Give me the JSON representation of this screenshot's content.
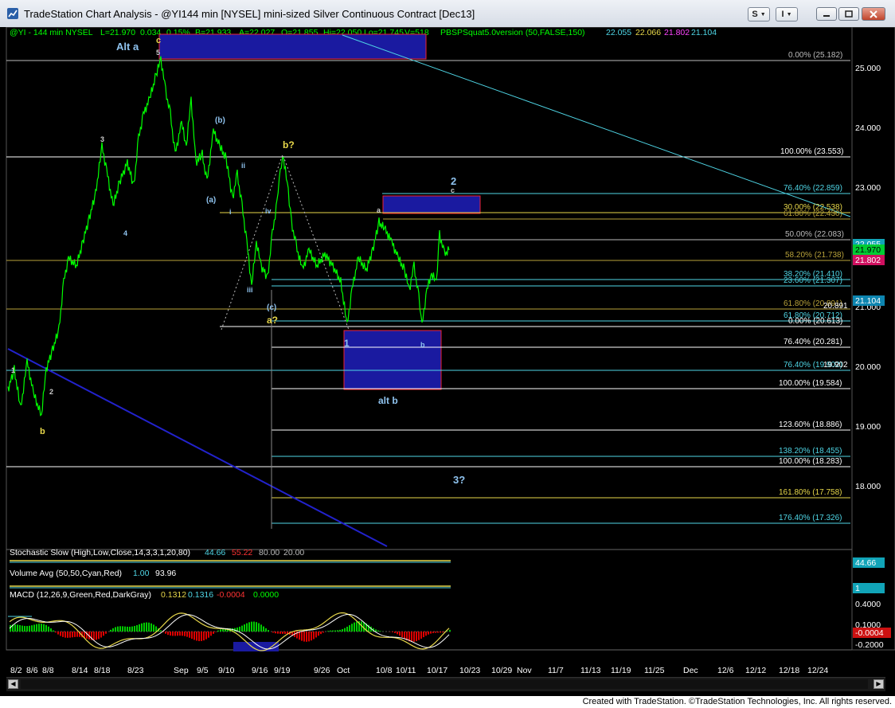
{
  "window": {
    "title": "TradeStation Chart Analysis - @YI144 min [NYSEL] mini-sized Silver Continuous Contract [Dec13]",
    "btn_s": "S",
    "btn_i": "I"
  },
  "header_line": {
    "symbol": "@YI - 144 min  NYSEL",
    "last": "L=21.970",
    "chg": "0.034",
    "pct": "0.15%",
    "bid": "B=21.933",
    "ask": "A=22.027",
    "open": "O=21.855",
    "high": "Hi=22.050",
    "low": "Lo=21.745",
    "vol": "V=518",
    "study": "PBSPSquat5.0version (50,FALSE,150)",
    "v1": "22.055",
    "v2": "22.066",
    "v3": "21.802",
    "v4": "21.104"
  },
  "colors": {
    "bg": "#000000",
    "price": "#00ff00",
    "fib_line": "#b9c0c6",
    "trend_cyan": "#4fd6e6",
    "trend_blue": "#2222cc",
    "box_blue": "#1a1aa0",
    "wave_yellow": "#e8d84a",
    "wave_blue": "#8fc3ef"
  },
  "price_axis": {
    "labels": [
      "25.000",
      "24.000",
      "23.000",
      "22.000",
      "21.000",
      "20.000",
      "19.000",
      "18.000"
    ],
    "badges": [
      "22.055",
      "21.970",
      "21.802",
      "21.104"
    ]
  },
  "fib_labels": [
    "0.00% (25.182)",
    "100.00% (23.553)",
    "76.40% (22.859)",
    "30.00% (22.538)",
    "61.80% (22.430)",
    "50.00% (22.083)",
    "58.20% (21.738)",
    "38.20% (21.410)",
    "23.60% (21.307)",
    "61.80% (20.891)",
    "20.891",
    "61.80% (20.712)",
    "0.00% (20.613)",
    "76.40% (20.281)",
    "76.40% (19.902)",
    "19.902",
    "100.00% (19.584)",
    "123.60% (18.886)",
    "138.20% (18.455)",
    "100.00% (18.283)",
    "161.80% (17.758)",
    "176.40% (17.326)"
  ],
  "wave_labels": [
    "Alt a",
    "c",
    "5",
    "3",
    "4",
    "1",
    "2",
    "b",
    "(b)",
    "(a)",
    "ii",
    "i",
    "iv",
    "iii",
    "b?",
    "(c)",
    "a?",
    "a",
    "2",
    "c",
    "1",
    "b",
    "alt b",
    "3?"
  ],
  "x_axis": [
    "8/2",
    "8/6",
    "8/8",
    "8/14",
    "8/18",
    "8/23",
    "Sep",
    "9/5",
    "9/10",
    "9/16",
    "9/19",
    "9/26",
    "Oct",
    "10/8",
    "10/11",
    "10/17",
    "10/23",
    "10/29",
    "Nov",
    "11/7",
    "11/13",
    "11/19",
    "11/25",
    "Dec",
    "12/6",
    "12/12",
    "12/18",
    "12/24"
  ],
  "indicators": {
    "stoch": {
      "label": "Stochastic Slow (High,Low,Close,14,3,3,1,20,80)",
      "v1": "44.66",
      "v2": "55.22",
      "v3": "80.00",
      "v4": "20.00",
      "badge": "44.66"
    },
    "volume": {
      "label": "Volume Avg (50,50,Cyan,Red)",
      "v1": "1.00",
      "v2": "93.96",
      "badge": "1"
    },
    "macd": {
      "label": "MACD (12,26,9,Green,Red,DarkGray)",
      "v1": "0.1312",
      "v2": "0.1316",
      "v3": "-0.0004",
      "v4": "0.0000",
      "axis": [
        "0.4000",
        "0.1000",
        "-0.0004",
        "-0.2000"
      ]
    }
  },
  "footer": "Created with TradeStation. ©TradeStation Technologies, Inc. All rights reserved."
}
